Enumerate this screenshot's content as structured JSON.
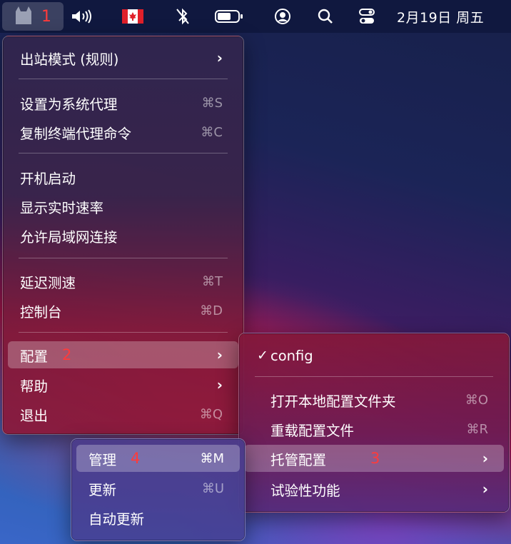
{
  "menubar": {
    "annotation_1": "1",
    "date": "2月19日 周五"
  },
  "main_menu": {
    "outbound_mode": "出站模式 (规则)",
    "set_system_proxy": "设置为系统代理",
    "set_system_proxy_shortcut": "⌘S",
    "copy_terminal_cmd": "复制终端代理命令",
    "copy_terminal_cmd_shortcut": "⌘C",
    "launch_at_login": "开机启动",
    "show_speed": "显示实时速率",
    "allow_lan": "允许局域网连接",
    "latency_test": "延迟测速",
    "latency_test_shortcut": "⌘T",
    "dashboard": "控制台",
    "dashboard_shortcut": "⌘D",
    "config": "配置",
    "config_annotation": "2",
    "help": "帮助",
    "quit": "退出",
    "quit_shortcut": "⌘Q"
  },
  "config_menu": {
    "current_config": "config",
    "open_folder": "打开本地配置文件夹",
    "open_folder_shortcut": "⌘O",
    "reload": "重载配置文件",
    "reload_shortcut": "⌘R",
    "remote_config": "托管配置",
    "remote_config_annotation": "3",
    "experimental": "试验性功能"
  },
  "remote_menu": {
    "manage": "管理",
    "manage_annotation": "4",
    "manage_shortcut": "⌘M",
    "update": "更新",
    "update_shortcut": "⌘U",
    "auto_update": "自动更新"
  },
  "colors": {
    "annotation": "#ff3b3b",
    "menubar": "#10183f",
    "highlight": "rgba(255,255,255,0.26)"
  }
}
